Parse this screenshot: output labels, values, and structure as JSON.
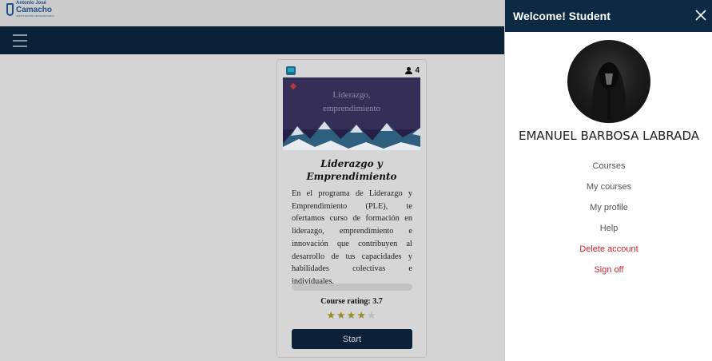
{
  "logo": {
    "line1": "Antonio José",
    "line2": "Camacho",
    "line3": "INSTITUCIÓN UNIVERSITARIA"
  },
  "course_card": {
    "user_count": "4",
    "image_title_line1": "Liderazgo,",
    "image_title_line2": "emprendimiento",
    "title_line1": "Liderazgo y",
    "title_line2": "Emprendimiento",
    "description": "En el programa de Liderazgo y Emprendimiento (PLE), te ofertamos curso de formación en liderazgo, emprendimiento e innovación que contribuyen al desarrollo de tus capacidades y habilidades colectivas e individuales.",
    "progress": 0,
    "rating_label": "Course rating: 3.7",
    "rating_value": 3.7,
    "rating_max": 5,
    "start_label": "Start"
  },
  "panel": {
    "title": "Welcome! Student",
    "user_name": "EMANUEL BARBOSA LABRADA",
    "menu": {
      "courses": "Courses",
      "my_courses": "My courses",
      "my_profile": "My profile",
      "help": "Help",
      "delete_account": "Delete account",
      "sign_off": "Sign off"
    }
  },
  "colors": {
    "navbar": "#0a2137",
    "panel_header": "#0d2a45",
    "danger": "#d9232d",
    "star": "#9a8a2a"
  },
  "icons": [
    "menu-icon",
    "course-icon",
    "user-icon",
    "close-icon",
    "star-icon"
  ]
}
